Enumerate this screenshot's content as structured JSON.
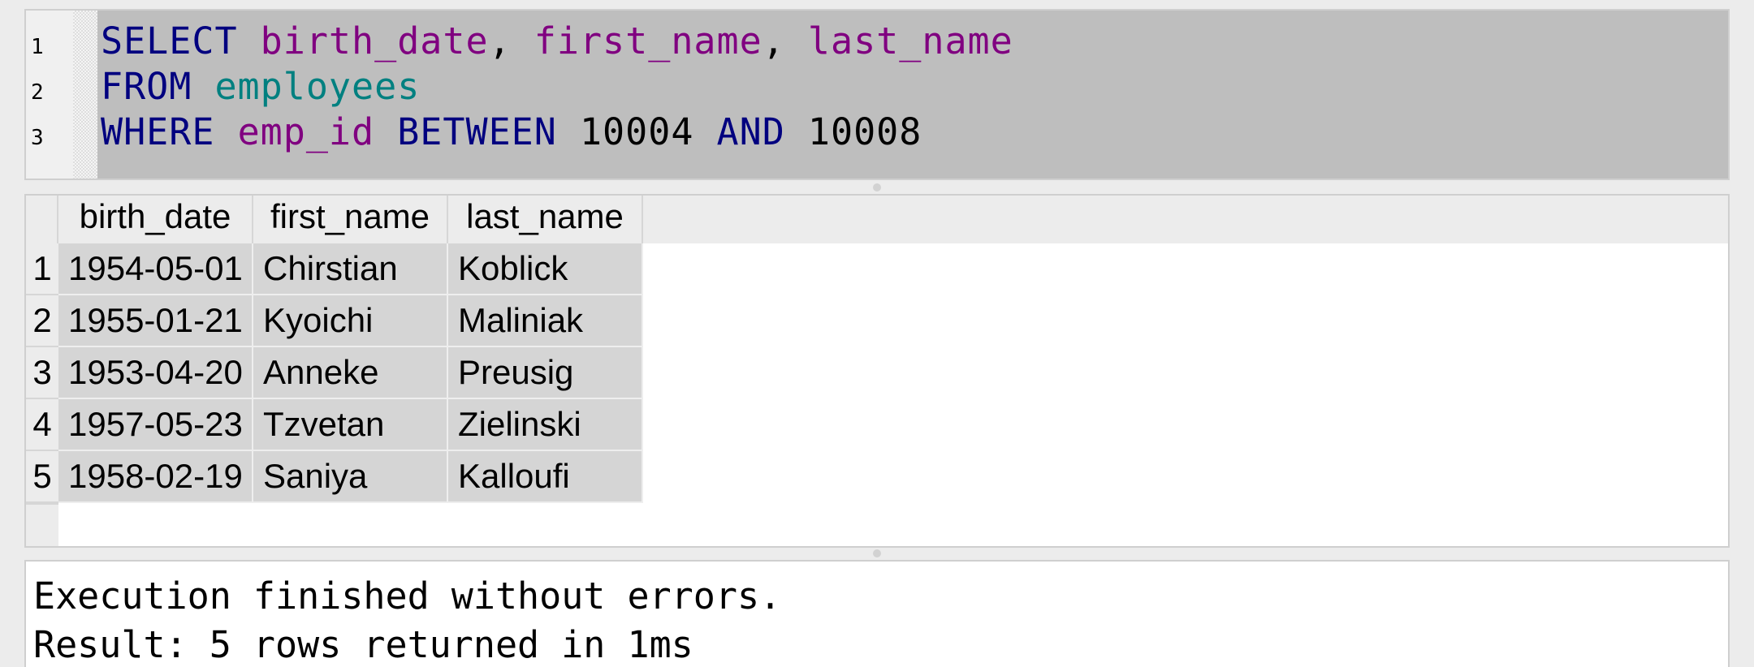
{
  "editor": {
    "line_numbers": [
      "1",
      "2",
      "3"
    ],
    "lines": [
      [
        {
          "text": "SELECT",
          "kind": "keyword"
        },
        {
          "text": " ",
          "kind": "plain"
        },
        {
          "text": "birth_date",
          "kind": "identifier"
        },
        {
          "text": ", ",
          "kind": "plain"
        },
        {
          "text": "first_name",
          "kind": "identifier"
        },
        {
          "text": ", ",
          "kind": "plain"
        },
        {
          "text": "last_name",
          "kind": "identifier"
        }
      ],
      [
        {
          "text": "FROM",
          "kind": "keyword"
        },
        {
          "text": " ",
          "kind": "plain"
        },
        {
          "text": "employees",
          "kind": "table"
        }
      ],
      [
        {
          "text": "WHERE",
          "kind": "keyword"
        },
        {
          "text": " ",
          "kind": "plain"
        },
        {
          "text": "emp_id",
          "kind": "identifier"
        },
        {
          "text": " ",
          "kind": "plain"
        },
        {
          "text": "BETWEEN",
          "kind": "keyword"
        },
        {
          "text": " ",
          "kind": "plain"
        },
        {
          "text": "10004",
          "kind": "number"
        },
        {
          "text": " ",
          "kind": "plain"
        },
        {
          "text": "AND",
          "kind": "keyword"
        },
        {
          "text": " ",
          "kind": "plain"
        },
        {
          "text": "10008",
          "kind": "number"
        }
      ]
    ],
    "colors": {
      "keyword": "#00007f",
      "identifier": "#800080",
      "table": "#008080",
      "number": "#000000",
      "background": "#bebebe"
    }
  },
  "results": {
    "columns": [
      "birth_date",
      "first_name",
      "last_name"
    ],
    "rows": [
      {
        "num": "1",
        "cells": [
          "1954-05-01",
          "Chirstian",
          "Koblick"
        ]
      },
      {
        "num": "2",
        "cells": [
          "1955-01-21",
          "Kyoichi",
          "Maliniak"
        ]
      },
      {
        "num": "3",
        "cells": [
          "1953-04-20",
          "Anneke",
          "Preusig"
        ]
      },
      {
        "num": "4",
        "cells": [
          "1957-05-23",
          "Tzvetan",
          "Zielinski"
        ]
      },
      {
        "num": "5",
        "cells": [
          "1958-02-19",
          "Saniya",
          "Kalloufi"
        ]
      }
    ]
  },
  "messages": {
    "line1": "Execution finished without errors.",
    "line2": "Result: 5 rows returned in 1ms"
  }
}
